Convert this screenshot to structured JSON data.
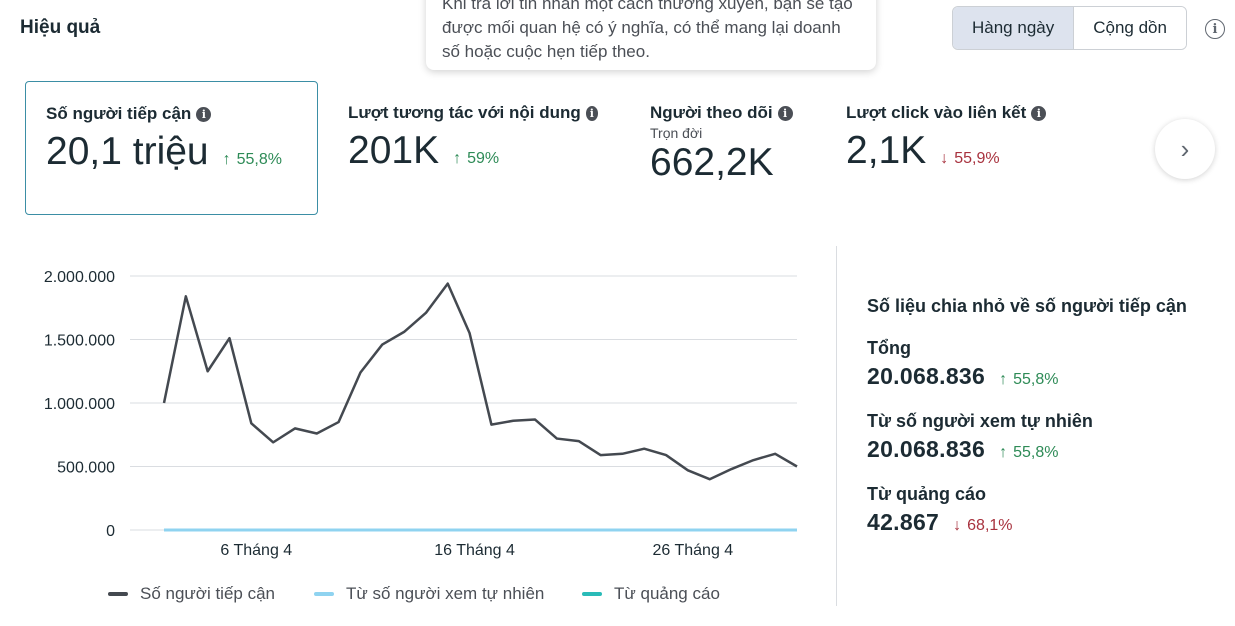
{
  "header": {
    "title": "Hiệu quả",
    "tooltip_text": "Khi trả lời tin nhắn một cách thường xuyên, bạn sẽ tạo được mối quan hệ có ý nghĩa, có thể mang lại doanh số hoặc cuộc hẹn tiếp theo.",
    "toggle": {
      "daily": "Hàng ngày",
      "cumulative": "Cộng dồn",
      "active": "daily"
    },
    "info_icon": "info-icon"
  },
  "metrics": [
    {
      "label": "Số người tiếp cận",
      "value": "20,1 triệu",
      "change": "55,8%",
      "direction": "up",
      "selected": true
    },
    {
      "label": "Lượt tương tác với nội dung",
      "value": "201K",
      "change": "59%",
      "direction": "up"
    },
    {
      "label": "Người theo dõi",
      "sub": "Trọn đời",
      "value": "662,2K"
    },
    {
      "label": "Lượt click vào liên kết",
      "value": "2,1K",
      "change": "55,9%",
      "direction": "down"
    }
  ],
  "glyphs": {
    "up_arrow": "↑",
    "down_arrow": "↓",
    "info": "i",
    "chevron_right": "›"
  },
  "colors": {
    "reach": "#444950",
    "organic": "#8fd3f0",
    "ads": "#2abbb8",
    "up": "#2e8b57",
    "down": "#a8323e",
    "selected_border": "#3b8ea5"
  },
  "chart_data": {
    "type": "line",
    "y_ticks": [
      "2.000.000",
      "1.500.000",
      "1.000.000",
      "500.000",
      "0"
    ],
    "ylim": [
      0,
      2000000
    ],
    "x_tick_labels": [
      {
        "index": 4,
        "label": "6 Tháng 4"
      },
      {
        "index": 14,
        "label": "16 Tháng 4"
      },
      {
        "index": 24,
        "label": "26 Tháng 4"
      }
    ],
    "series": [
      {
        "name": "Số người tiếp cận",
        "color": "#444950",
        "values": [
          1000000,
          1840000,
          1250000,
          1510000,
          840000,
          690000,
          800000,
          760000,
          850000,
          1240000,
          1460000,
          1560000,
          1710000,
          1940000,
          1550000,
          830000,
          860000,
          870000,
          720000,
          700000,
          590000,
          600000,
          640000,
          590000,
          470000,
          400000,
          480000,
          550000,
          600000,
          500000
        ]
      },
      {
        "name": "Từ số người xem tự nhiên",
        "color": "#8fd3f0",
        "values": [
          0,
          0,
          0,
          0,
          0,
          0,
          0,
          0,
          0,
          0,
          0,
          0,
          0,
          0,
          0,
          0,
          0,
          0,
          0,
          0,
          0,
          0,
          0,
          0,
          0,
          0,
          0,
          0,
          0,
          0
        ]
      },
      {
        "name": "Từ quảng cáo",
        "color": "#2abbb8",
        "values": [
          0,
          0,
          0,
          0,
          0,
          0,
          0,
          0,
          0,
          0,
          0,
          0,
          0,
          0,
          0,
          0,
          0,
          0,
          0,
          0,
          0,
          0,
          0,
          0,
          0,
          0,
          0,
          0,
          0,
          0
        ]
      }
    ]
  },
  "breakdown": {
    "title": "Số liệu chia nhỏ về số người tiếp cận",
    "items": [
      {
        "label": "Tổng",
        "value": "20.068.836",
        "change": "55,8%",
        "direction": "up"
      },
      {
        "label": "Từ số người xem tự nhiên",
        "value": "20.068.836",
        "change": "55,8%",
        "direction": "up"
      },
      {
        "label": "Từ quảng cáo",
        "value": "42.867",
        "change": "68,1%",
        "direction": "down"
      }
    ]
  }
}
